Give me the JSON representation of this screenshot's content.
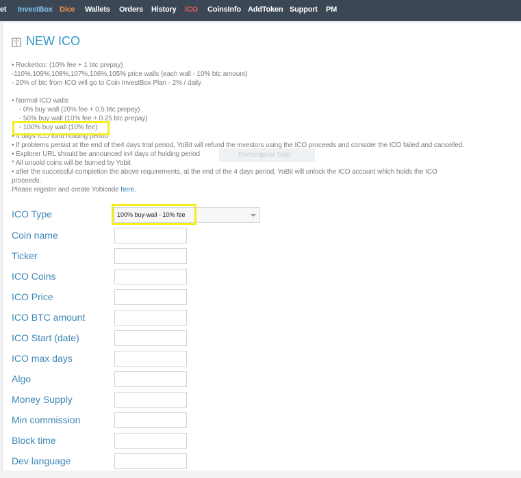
{
  "nav": {
    "items": [
      "et",
      "InvestBox",
      "Dice",
      "Wallets",
      "Orders",
      "History",
      "ICO",
      "CoinsInfo",
      "AddToken",
      "Support",
      "PM"
    ]
  },
  "page": {
    "title": "NEW ICO"
  },
  "info": {
    "lines": [
      "• RocketIco: (10% fee + 1 btc prepay)",
      "-110%,109%,108%,107%,106%,105% price walls (each wall - 10% btc amount)",
      "- 20% of btc from ICO will go to Coin InvestBox Plan - 2% / daily",
      "• Normal ICO walls:",
      "- 0% buy wall (20% fee + 0.5 btc prepay)",
      "- 50% buy wall (10% fee + 0.25 btc prepay)",
      "- 100% buy wall (10% fee)",
      "• 4 days ICO fund holding period",
      "• If problems persist at the end of the4 days trial period, YoBit will refund the investors using the ICO proceeds and consider the ICO failed and cancelled.",
      "• Explorer URL should be announced in4 days of holding period",
      "* All unsold coins will be burned by Yobit",
      "• after the successful completion the above requirements, at the end of the 4 days period, YoBit will unlock the ICO account which holds the ICO",
      "proceeds.",
      "Please register and create Yobicode"
    ],
    "link": "here.",
    "overlay": "Rectangular Snip"
  },
  "form": {
    "ico_type_label": "ICO Type",
    "ico_type_value": "100% buy-wall - 10% fee",
    "fields": [
      "Coin name",
      "Ticker",
      "ICO Coins",
      "ICO Price",
      "ICO BTC amount",
      "ICO Start (date)",
      "ICO max days",
      "Algo",
      "Money Supply",
      "Min commission",
      "Block time",
      "Dev language"
    ]
  },
  "colors": {
    "nav_bg": "#3c4756",
    "accent": "#3198c8",
    "highlight": "#f5ee1c"
  }
}
